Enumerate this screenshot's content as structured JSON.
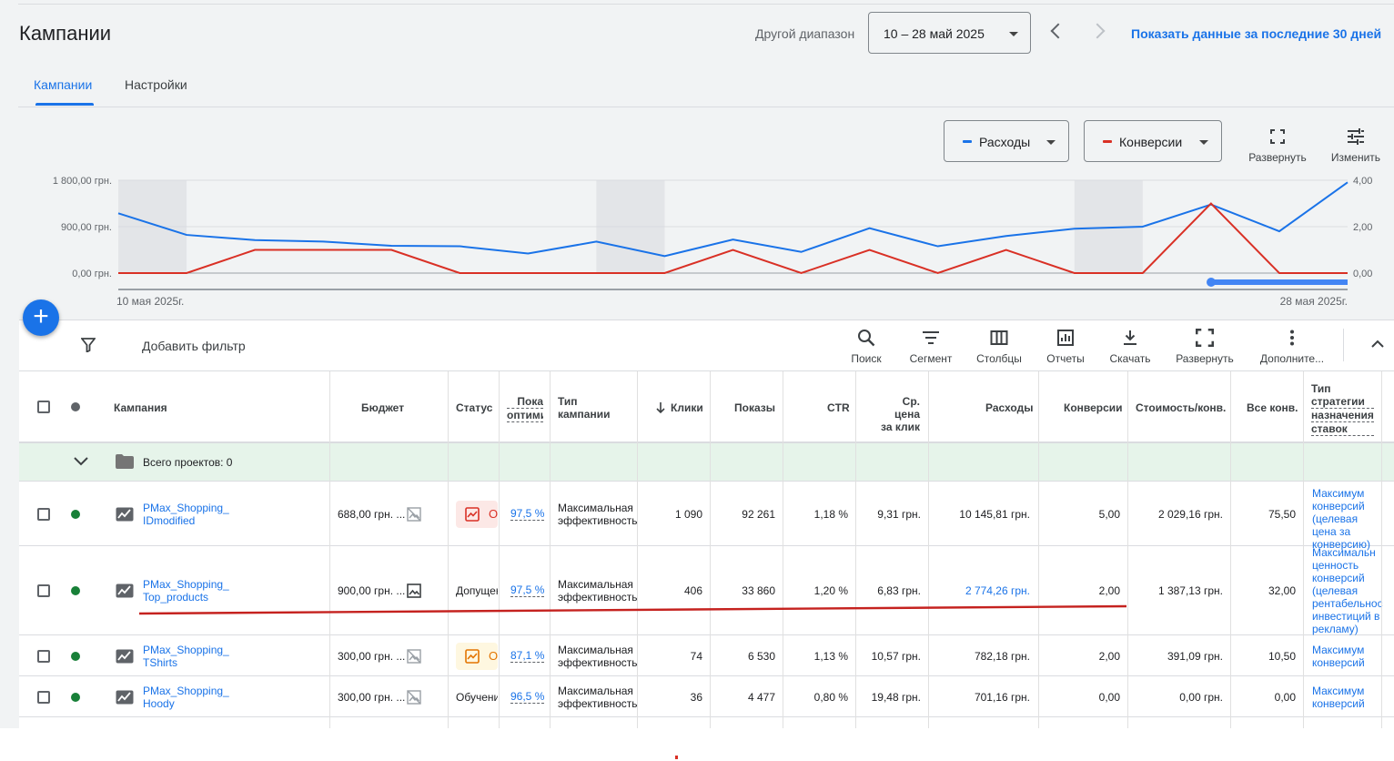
{
  "header": {
    "title": "Кампании",
    "range_label": "Другой диапазон",
    "date_range": "10 – 28 май 2025",
    "show_30_days": "Показать данные за последние 30 дней"
  },
  "tabs": [
    {
      "label": "Кампании",
      "active": true
    },
    {
      "label": "Настройки",
      "active": false
    }
  ],
  "metrics": [
    {
      "label": "Расходы",
      "color": "#1a73e8"
    },
    {
      "label": "Конверсии",
      "color": "#d93025"
    }
  ],
  "chart_tools": {
    "expand": "Развернуть",
    "edit": "Изменить"
  },
  "chart_data": {
    "type": "line",
    "x_start_label": "10 мая 2025г.",
    "x_end_label": "28 мая 2025г.",
    "x": [
      "10 мая",
      "11 мая",
      "12 мая",
      "13 мая",
      "14 мая",
      "15 мая",
      "16 мая",
      "17 мая",
      "18 мая",
      "19 мая",
      "20 мая",
      "21 мая",
      "22 мая",
      "23 мая",
      "24 мая",
      "25 мая",
      "26 мая",
      "27 мая",
      "28 мая"
    ],
    "left_axis": {
      "ticks": [
        "0,00 грн.",
        "900,00 грн.",
        "1 800,00 грн."
      ],
      "ylim": [
        0,
        1800
      ]
    },
    "right_axis": {
      "ticks": [
        "0,00",
        "2,00",
        "4,00"
      ],
      "ylim": [
        0,
        4
      ]
    },
    "weekend_bands": [
      [
        0,
        1
      ],
      [
        7,
        8
      ],
      [
        14,
        15
      ]
    ],
    "series": [
      {
        "name": "Расходы",
        "axis": "left",
        "color": "#1a73e8",
        "values": [
          1160,
          740,
          640,
          610,
          530,
          520,
          380,
          610,
          330,
          650,
          410,
          870,
          520,
          720,
          860,
          900,
          1330,
          810,
          1760
        ]
      },
      {
        "name": "Конверсии",
        "axis": "right",
        "color": "#d93025",
        "values": [
          0,
          0,
          1,
          1,
          1,
          0,
          0,
          0,
          0,
          1,
          0,
          1,
          0,
          1,
          0,
          0,
          3,
          0,
          0
        ]
      }
    ],
    "grid": true
  },
  "table_toolbar": {
    "add_filter": "Добавить фильтр",
    "tools": [
      "Поиск",
      "Сегмент",
      "Столбцы",
      "Отчеты",
      "Скачать",
      "Развернуть",
      "Дополните..."
    ]
  },
  "table": {
    "columns": {
      "campaign": "Кампания",
      "budget": "Бюджет",
      "status": "Статус",
      "opt_score": [
        "Пока",
        "оптими"
      ],
      "type": [
        "Тип",
        "кампании"
      ],
      "clicks": "Клики",
      "impr": "Показы",
      "ctr": "CTR",
      "cpc": [
        "Ср. цена",
        "за клик"
      ],
      "cost": "Расходы",
      "conv": "Конверсии",
      "cost_conv": "Стоимость/конв.",
      "all_conv": "Все конв.",
      "bid_strategy": [
        "Тип",
        "стратегии",
        "назначения",
        "ставок"
      ]
    },
    "total_label": "Всего проектов: 0",
    "rows": [
      {
        "name": [
          "PMax_Shopping_",
          "IDmodified"
        ],
        "budget": "688,00 грн. ...",
        "status": "О",
        "status_kind": "red",
        "opt": "97,5 %",
        "type": [
          "Максимальная",
          "эффективность"
        ],
        "clicks": "1 090",
        "impr": "92 261",
        "ctr": "1,18 %",
        "cpc": "9,31 грн.",
        "cost": "10 145,81 грн.",
        "cost_link": false,
        "conv": "5,00",
        "cost_conv": "2 029,16 грн.",
        "all_conv": "75,50",
        "bid": [
          "Максимум",
          "конверсий",
          "(целевая",
          "цена за",
          "конверсию)"
        ]
      },
      {
        "name": [
          "PMax_Shopping_",
          "Top_products"
        ],
        "budget": "900,00 грн. ...",
        "status": "Допущен",
        "status_kind": "text",
        "opt": "97,5 %",
        "type": [
          "Максимальная",
          "эффективность"
        ],
        "clicks": "406",
        "impr": "33 860",
        "ctr": "1,20 %",
        "cpc": "6,83 грн.",
        "cost": "2 774,26 грн.",
        "cost_link": true,
        "conv": "2,00",
        "cost_conv": "1 387,13 грн.",
        "all_conv": "32,00",
        "bid": [
          "Максимальн",
          "ценность",
          "конверсий",
          "(целевая",
          "рентабельнос",
          "инвестиций в",
          "рекламу)"
        ]
      },
      {
        "name": [
          "PMax_Shopping_",
          "TShirts"
        ],
        "budget": "300,00 грн. ...",
        "status": "О",
        "status_kind": "yellow",
        "opt": "87,1 %",
        "type": [
          "Максимальная",
          "эффективность"
        ],
        "clicks": "74",
        "impr": "6 530",
        "ctr": "1,13 %",
        "cpc": "10,57 грн.",
        "cost": "782,18 грн.",
        "cost_link": false,
        "conv": "2,00",
        "cost_conv": "391,09 грн.",
        "all_conv": "10,50",
        "bid": [
          "Максимум",
          "конверсий"
        ]
      },
      {
        "name": [
          "PMax_Shopping_",
          "Hoody"
        ],
        "budget": "300,00 грн. ...",
        "status": "Обучени",
        "status_kind": "text",
        "opt": "96,5 %",
        "type": [
          "Максимальная",
          "эффективность"
        ],
        "clicks": "36",
        "impr": "4 477",
        "ctr": "0,80 %",
        "cpc": "19,48 грн.",
        "cost": "701,16 грн.",
        "cost_link": false,
        "conv": "0,00",
        "cost_conv": "0,00 грн.",
        "all_conv": "0,00",
        "bid": [
          "Максимум",
          "конверсий"
        ]
      }
    ]
  }
}
